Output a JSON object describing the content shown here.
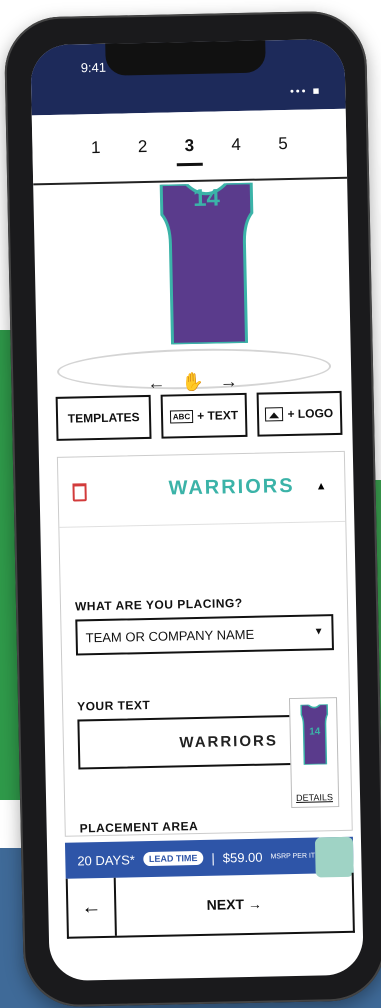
{
  "status": {
    "time": "9:41",
    "icons": "••• ■"
  },
  "steps": [
    "1",
    "2",
    "3",
    "4",
    "5"
  ],
  "active_step": "3",
  "jersey": {
    "number": "14",
    "color": "#5a3b8c",
    "trim": "#3bb3a8"
  },
  "rotate": {
    "left": "←",
    "right": "→"
  },
  "tools": {
    "templates": "TEMPLATES",
    "text": "+ TEXT",
    "text_icon_label": "ABC",
    "logo": "+ LOGO"
  },
  "panel": {
    "heading": "WARRIORS",
    "placing_label": "WHAT ARE YOU PLACING?",
    "placing_value": "TEAM OR COMPANY NAME",
    "your_text_label": "YOUR TEXT",
    "your_text_value": "WARRIORS",
    "details": "DETAILS",
    "placement_label": "PLACEMENT AREA"
  },
  "info_bar": {
    "days": "20 DAYS*",
    "lead_time": "LEAD TIME",
    "price": "$59.00",
    "msrp": "MSRP PER ITEM"
  },
  "nav": {
    "back": "←",
    "next": "NEXT →"
  }
}
